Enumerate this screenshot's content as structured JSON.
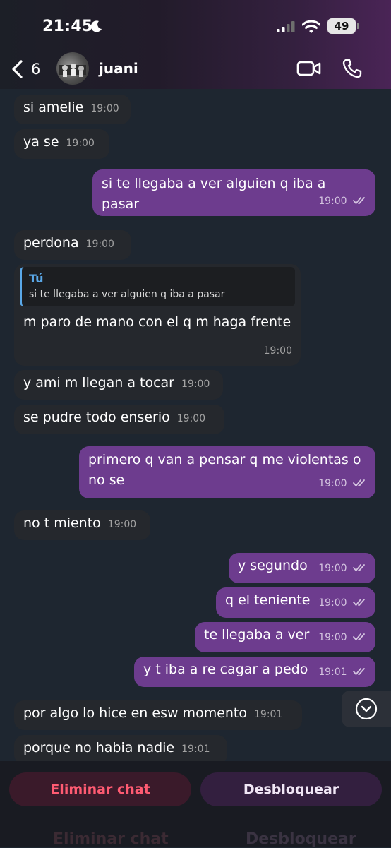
{
  "status_bar": {
    "time": "21:45",
    "battery": "49"
  },
  "header": {
    "back_count": "6",
    "contact_name": "juani"
  },
  "messages": [
    {
      "text": "si amelie",
      "time": "19:00"
    },
    {
      "text": "ya se",
      "time": "19:00"
    },
    {
      "text": "si te llegaba a ver alguien q iba a pasar",
      "time": "19:00"
    },
    {
      "text": "perdona",
      "time": "19:00"
    },
    {
      "reply_name": "Tú",
      "reply_text": "si te llegaba a ver alguien q iba a pasar",
      "text": "m paro de mano con el q m haga frente",
      "time": "19:00"
    },
    {
      "text": "y ami m llegan a tocar",
      "time": "19:00"
    },
    {
      "text": "se pudre todo enserio",
      "time": "19:00"
    },
    {
      "text": "primero q van a pensar q me violentas o no se",
      "time": "19:00"
    },
    {
      "text": "no t miento",
      "time": "19:00"
    },
    {
      "text": "y segundo",
      "time": "19:00"
    },
    {
      "text": "q el teniente",
      "time": "19:00"
    },
    {
      "text": "te llegaba a ver",
      "time": "19:00"
    },
    {
      "text": "y t iba a re cagar a pedo",
      "time": "19:01"
    },
    {
      "text": "por algo lo hice en esw momento",
      "time": "19:01"
    },
    {
      "text": "porque no habia nadie",
      "time": "19:01"
    }
  ],
  "actions": {
    "delete_chat": "Eliminar chat",
    "unblock": "Desbloquear"
  },
  "colors": {
    "outgoing_bubble": "#6d3c8e",
    "incoming_bubble": "#25282d",
    "delete_text": "#ff5b72",
    "reply_accent": "#5aa8e8"
  },
  "icons": [
    "moon-icon",
    "signal-icon",
    "wifi-icon",
    "battery-icon",
    "back-chevron-icon",
    "video-call-icon",
    "phone-call-icon",
    "double-check-icon",
    "chevron-down-icon"
  ]
}
